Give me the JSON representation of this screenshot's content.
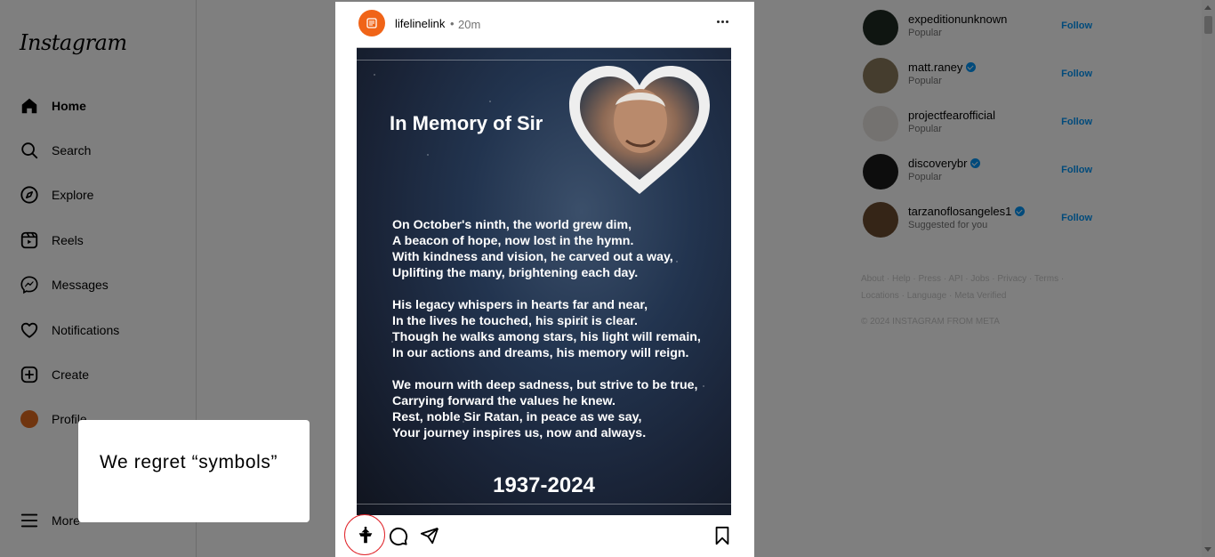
{
  "app": {
    "logo": "Instagram"
  },
  "sidebar": {
    "items": [
      {
        "label": "Home",
        "icon": "home-icon",
        "active": true
      },
      {
        "label": "Search",
        "icon": "search-icon"
      },
      {
        "label": "Explore",
        "icon": "compass-icon"
      },
      {
        "label": "Reels",
        "icon": "reels-icon"
      },
      {
        "label": "Messages",
        "icon": "messenger-icon"
      },
      {
        "label": "Notifications",
        "icon": "heart-icon"
      },
      {
        "label": "Create",
        "icon": "plus-square-icon"
      },
      {
        "label": "Profile",
        "icon": "avatar"
      }
    ],
    "more": "More"
  },
  "post": {
    "username": "lifelinelink",
    "separator": "•",
    "time": "20m",
    "image": {
      "title": "In Memory of Sir",
      "stanzas": [
        [
          "On October's ninth, the world grew dim,",
          "A beacon of hope, now lost in the hymn.",
          "With kindness and vision, he carved out a way,",
          "Uplifting the many, brightening each day."
        ],
        [
          "His legacy whispers in hearts far and near,",
          "In the lives he touched, his spirit is clear.",
          "Though he walks among stars, his light will remain,",
          "In our actions and dreams, his memory will reign."
        ],
        [
          "We mourn with deep sadness, but strive to be true,",
          "Carrying forward the values he knew.",
          "Rest, noble Sir Ratan, in peace as we say,",
          "Your journey inspires us, now and always."
        ]
      ],
      "years": "1937-2024"
    }
  },
  "suggestions": [
    {
      "name": "expeditionunknown",
      "sub": "Popular",
      "follow": "Follow",
      "verified": false,
      "color": "#1f2a22"
    },
    {
      "name": "matt.raney",
      "sub": "Popular",
      "follow": "Follow",
      "verified": true,
      "color": "#8a7a5c"
    },
    {
      "name": "projectfearofficial",
      "sub": "Popular",
      "follow": "Follow",
      "verified": false,
      "color": "#e9e4e0"
    },
    {
      "name": "discoverybr",
      "sub": "Popular",
      "follow": "Follow",
      "verified": true,
      "color": "#1a1a1a"
    },
    {
      "name": "tarzanoflosangeles1",
      "sub": "Suggested for you",
      "follow": "Follow",
      "verified": true,
      "color": "#6b4a2e"
    }
  ],
  "footer": {
    "links_line1": "About · Help · Press · API · Jobs · Privacy · Terms ·",
    "links_line2": "Locations · Language · Meta Verified",
    "copyright": "© 2024 INSTAGRAM FROM META"
  },
  "tooltip": {
    "text": "We regret “symbols”"
  },
  "colors": {
    "accent": "#0095f6",
    "highlight": "#e0242a",
    "avatar": "#f06418"
  }
}
